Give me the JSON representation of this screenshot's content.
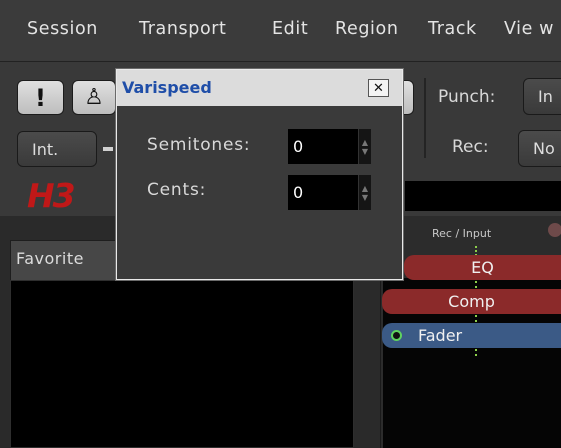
{
  "menubar": {
    "items": [
      "Session",
      "Transport",
      "Edit",
      "Region",
      "Track",
      "Vie w"
    ]
  },
  "toolbar": {
    "alert_glyph": "!",
    "metronome_glyph": "♙",
    "int_label": "Int.",
    "punch_label": "Punch:",
    "punch_button": "In",
    "rec_label": "Rec:",
    "rec_button": "No"
  },
  "logo_text": "H3",
  "favorites_tab": "Favorite",
  "strip": {
    "header": "Rec / Input",
    "processors": [
      "EQ",
      "Comp",
      "Fader"
    ]
  },
  "dialog": {
    "title": "Varispeed",
    "close_glyph": "✕",
    "semitones_label": "Semitones:",
    "semitones_value": "0",
    "cents_label": "Cents:",
    "cents_value": "0"
  },
  "colors": {
    "eq": "#8b2a2a",
    "comp": "#8b2a2a",
    "fader": "#3b5a86",
    "title": "#1f4ea8",
    "logo": "#c01818"
  }
}
